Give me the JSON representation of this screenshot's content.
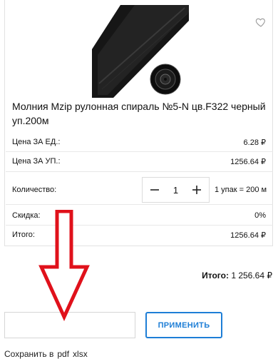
{
  "product": {
    "title": "Молния Mzip рулонная спираль №5-N цв.F322 черный уп.200м",
    "image_icon": "zipper-roll-image",
    "favorite_icon": "heart-outline-icon"
  },
  "prices": {
    "unit_label": "Цена ЗА ЕД.:",
    "unit_value": "6.28 ₽",
    "pack_label": "Цена ЗА УП.:",
    "pack_value": "1256.64 ₽"
  },
  "quantity": {
    "label": "Количество:",
    "value": "1",
    "minus": "−",
    "plus": "+",
    "pack_note": "1 упак = 200 м"
  },
  "discount": {
    "label": "Скидка:",
    "value": "0%"
  },
  "itogo": {
    "label": "Итого:",
    "value": "1256.64 ₽"
  },
  "summary": {
    "label": "Итого:",
    "value": "1 256.64 ₽"
  },
  "promo": {
    "value": "",
    "button_label": "ПРИМЕНИТЬ"
  },
  "save": {
    "label": "Сохранить в",
    "pdf": "pdf",
    "xlsx": "xlsx"
  },
  "colors": {
    "accent": "#1e7ed6",
    "arrow": "#e0111b",
    "border": "#e2e2e2"
  }
}
